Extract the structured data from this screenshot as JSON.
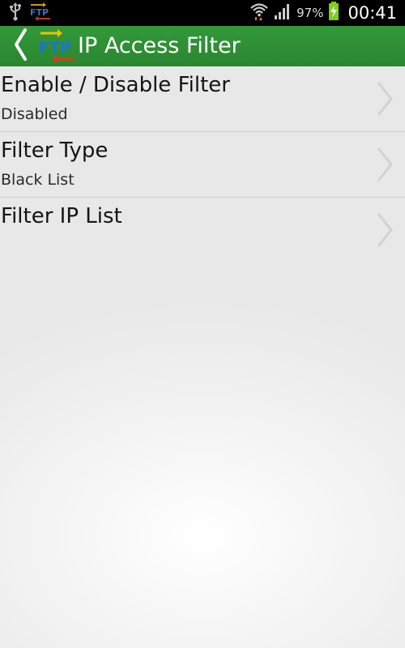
{
  "status_bar": {
    "battery_percent": "97%",
    "time": "00:41",
    "icons": [
      "usb-icon",
      "ftp-notification-icon",
      "wifi-icon",
      "signal-icon",
      "battery-charging-icon"
    ]
  },
  "action_bar": {
    "title": "IP Access Filter",
    "logo_text": "FTP",
    "colors": {
      "bar": "#2f9134",
      "logo_text": "#1a73d9",
      "arrow_right": "#f2c200",
      "arrow_left": "#e03a1a"
    }
  },
  "preferences": [
    {
      "title": "Enable / Disable Filter",
      "summary": "Disabled"
    },
    {
      "title": "Filter Type",
      "summary": "Black List"
    },
    {
      "title": "Filter IP List",
      "summary": ""
    }
  ]
}
